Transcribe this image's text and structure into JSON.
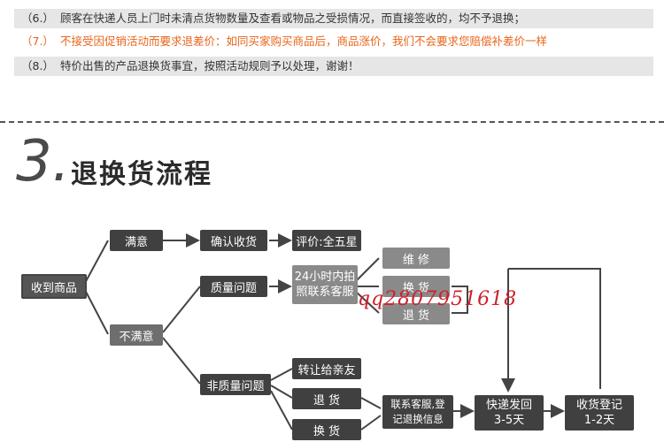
{
  "rules": [
    {
      "num": "（6.）",
      "text": "顾客在快递人员上门时未清点货物数量及查看或物品之受损情况，而直接签收的，均不予退换；"
    },
    {
      "num": "（7.）",
      "text": "不接受因促销活动而要求退差价：如同买家购买商品后，商品涨价，我们不会要求您赔偿补差价一样"
    },
    {
      "num": "（8.）",
      "text": "特价出售的产品退换货事宜，按照活动规则予以处理，谢谢！"
    }
  ],
  "section": {
    "number": "3.",
    "title": "退换货流程"
  },
  "flow": {
    "receive": "收到商品",
    "satisfied": "满意",
    "confirm": "确认收货",
    "review": "评价:全五星",
    "unsatisfied": "不满意",
    "quality": "质量问题",
    "contact24_line1": "24小时内拍",
    "contact24_line2": "照联系客服",
    "repair": "维 修",
    "exchange1": "换 货",
    "return1": "退 货",
    "nonquality": "非质量问题",
    "transfer": "转让给亲友",
    "return2": "退 货",
    "exchange2": "换 货",
    "contact_line1": "联系客服,登",
    "contact_line2": "记退换信息",
    "ship_line1": "快递发回",
    "ship_line2": "3-5天",
    "register_line1": "收货登记",
    "register_line2": "1-2天"
  },
  "watermark": "qq2807951618",
  "colors": {
    "highlight": "#e8651c",
    "watermark": "#d0202a",
    "box_dark": "#404040",
    "box_light": "#8a8a8a"
  }
}
